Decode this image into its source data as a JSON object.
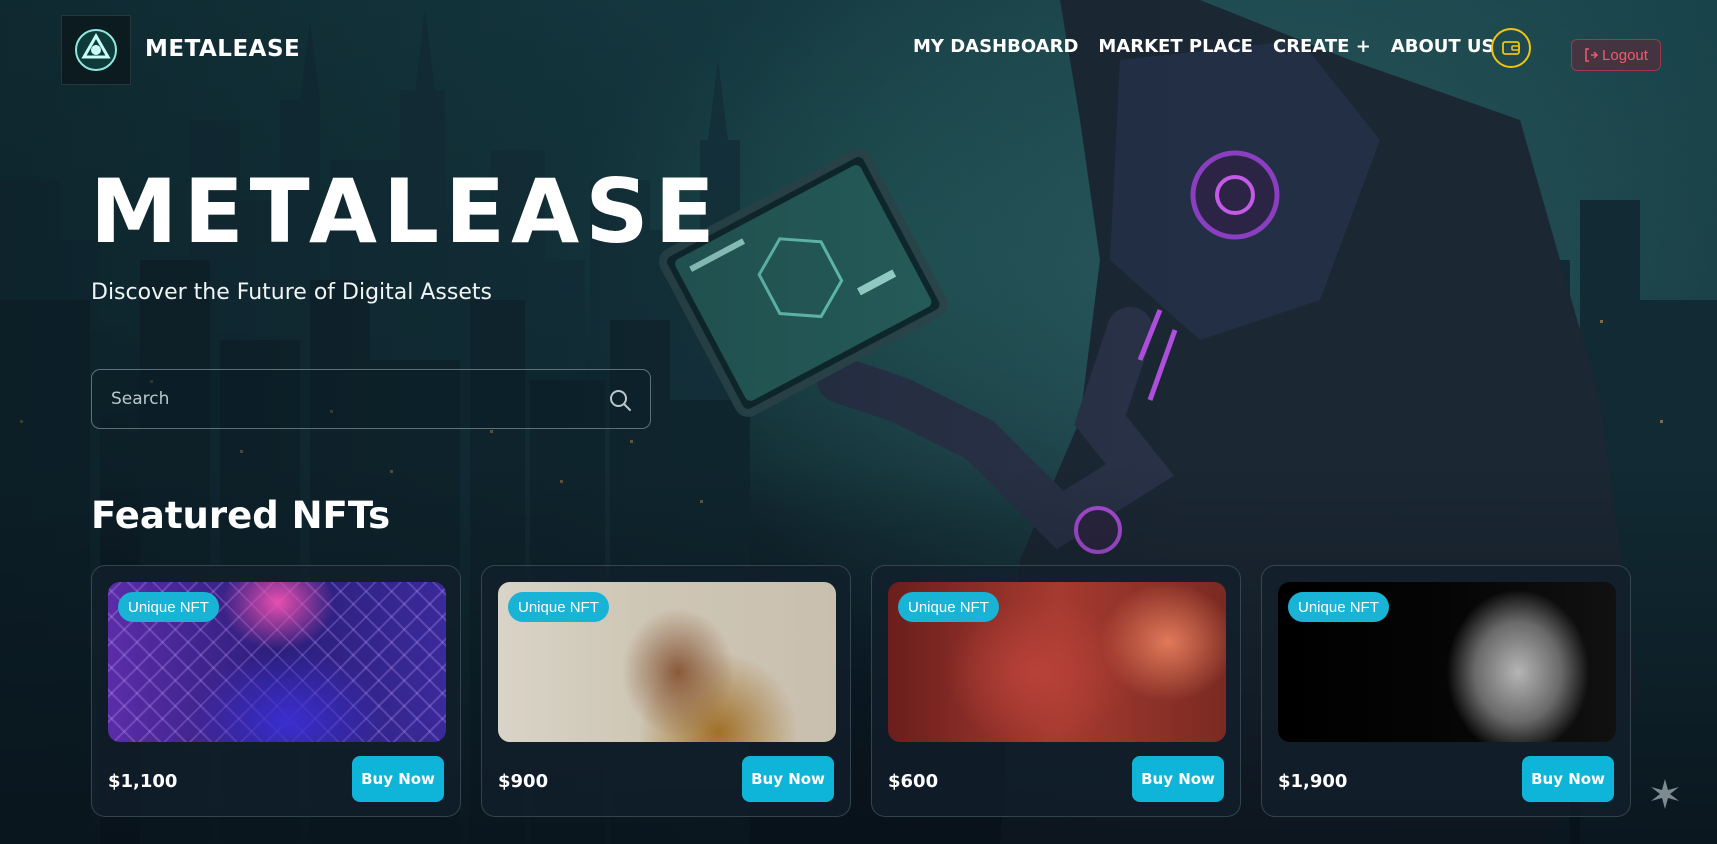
{
  "brand": {
    "name": "METALEASE"
  },
  "nav": {
    "items": [
      {
        "label": "MY DASHBOARD"
      },
      {
        "label": "MARKET PLACE"
      },
      {
        "label": "CREATE +"
      },
      {
        "label": "ABOUT US"
      }
    ],
    "wallet_icon": "wallet-icon",
    "logout_label": "Logout"
  },
  "hero": {
    "title": "METALEASE",
    "subtitle": "Discover the Future of Digital Assets"
  },
  "search": {
    "placeholder": "Search"
  },
  "featured": {
    "title": "Featured NFTs",
    "cards": [
      {
        "badge": "Unique NFT",
        "price": "$1,100",
        "button": "Buy Now"
      },
      {
        "badge": "Unique NFT",
        "price": "$900",
        "button": "Buy Now"
      },
      {
        "badge": "Unique NFT",
        "price": "$600",
        "button": "Buy Now"
      },
      {
        "badge": "Unique NFT",
        "price": "$1,900",
        "button": "Buy Now"
      }
    ]
  },
  "colors": {
    "accent": "#0fb5d9",
    "wallet": "#f1c40f",
    "logout": "#f25a6c"
  }
}
